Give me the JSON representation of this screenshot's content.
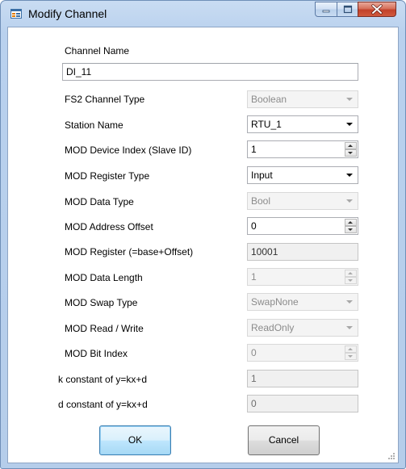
{
  "window": {
    "title": "Modify Channel",
    "controls": {
      "minimize": "minimize",
      "maximize": "maximize",
      "close": "close"
    }
  },
  "form": {
    "channel_name": {
      "label": "Channel Name",
      "value": "DI_11"
    },
    "fs2_channel_type": {
      "label": "FS2 Channel Type",
      "value": "Boolean",
      "enabled": false
    },
    "station_name": {
      "label": "Station Name",
      "value": "RTU_1",
      "enabled": true
    },
    "mod_device_index": {
      "label": "MOD Device Index (Slave ID)",
      "value": "1",
      "enabled": true
    },
    "mod_register_type": {
      "label": "MOD Register Type",
      "value": "Input",
      "enabled": true
    },
    "mod_data_type": {
      "label": "MOD Data Type",
      "value": "Bool",
      "enabled": false
    },
    "mod_address_offset": {
      "label": "MOD Address Offset",
      "value": "0",
      "enabled": true
    },
    "mod_register": {
      "label": "MOD Register (=base+Offset)",
      "value": "10001",
      "readonly": true
    },
    "mod_data_length": {
      "label": "MOD Data Length",
      "value": "1",
      "enabled": false
    },
    "mod_swap_type": {
      "label": "MOD Swap Type",
      "value": "SwapNone",
      "enabled": false
    },
    "mod_read_write": {
      "label": "MOD Read / Write",
      "value": "ReadOnly",
      "enabled": false
    },
    "mod_bit_index": {
      "label": "MOD Bit Index",
      "value": "0",
      "enabled": false
    },
    "k_constant": {
      "label": "k constant of y=kx+d",
      "value": "1",
      "readonly": true
    },
    "d_constant": {
      "label": "d constant of y=kx+d",
      "value": "0",
      "readonly": true
    }
  },
  "buttons": {
    "ok": "OK",
    "cancel": "Cancel"
  },
  "icons": {
    "app": "form-icon",
    "grip": "resize-grip-icon"
  },
  "colors": {
    "titlebar": "#c9dcf2",
    "close_button": "#c2412a",
    "default_button": "#3c7fb1"
  }
}
